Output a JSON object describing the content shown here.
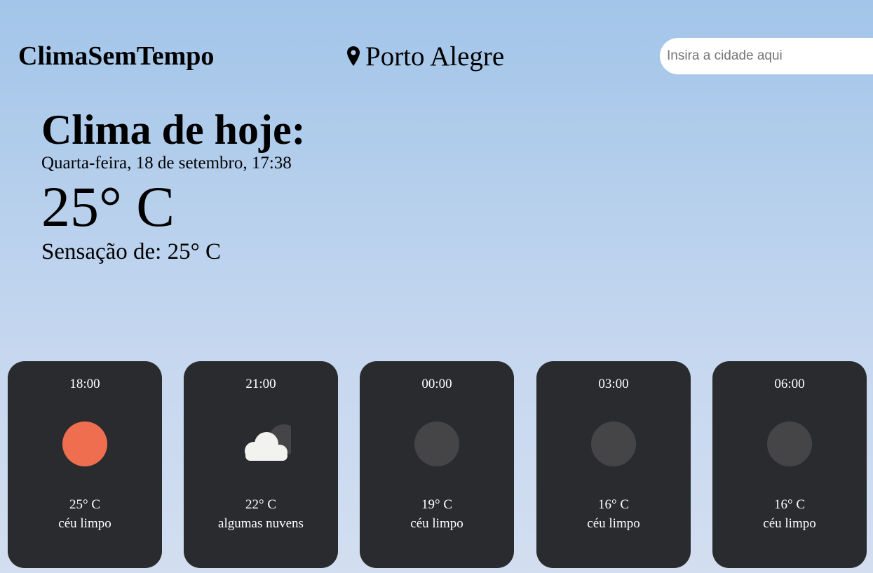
{
  "header": {
    "logo": "ClimaSemTempo",
    "location": "Porto Alegre",
    "search_placeholder": "Insira a cidade aqui",
    "pin_icon": "map-pin-icon"
  },
  "today": {
    "title": "Clima de hoje:",
    "date": "Quarta-feira, 18 de setembro, 17:38",
    "temperature": "25° C",
    "feels_like": "Sensação de: 25° C"
  },
  "forecast": [
    {
      "time": "18:00",
      "temp": "25° C",
      "desc": "céu limpo",
      "icon": "sun-icon"
    },
    {
      "time": "21:00",
      "temp": "22° C",
      "desc": "algumas nuvens",
      "icon": "cloud-moon-icon"
    },
    {
      "time": "00:00",
      "temp": "19° C",
      "desc": "céu limpo",
      "icon": "moon-icon"
    },
    {
      "time": "03:00",
      "temp": "16° C",
      "desc": "céu limpo",
      "icon": "moon-icon"
    },
    {
      "time": "06:00",
      "temp": "16° C",
      "desc": "céu limpo",
      "icon": "moon-icon"
    }
  ],
  "colors": {
    "card_bg": "#292b2f",
    "sun": "#ee6e4f",
    "moon": "#454547",
    "cloud": "#f2f2ef"
  }
}
